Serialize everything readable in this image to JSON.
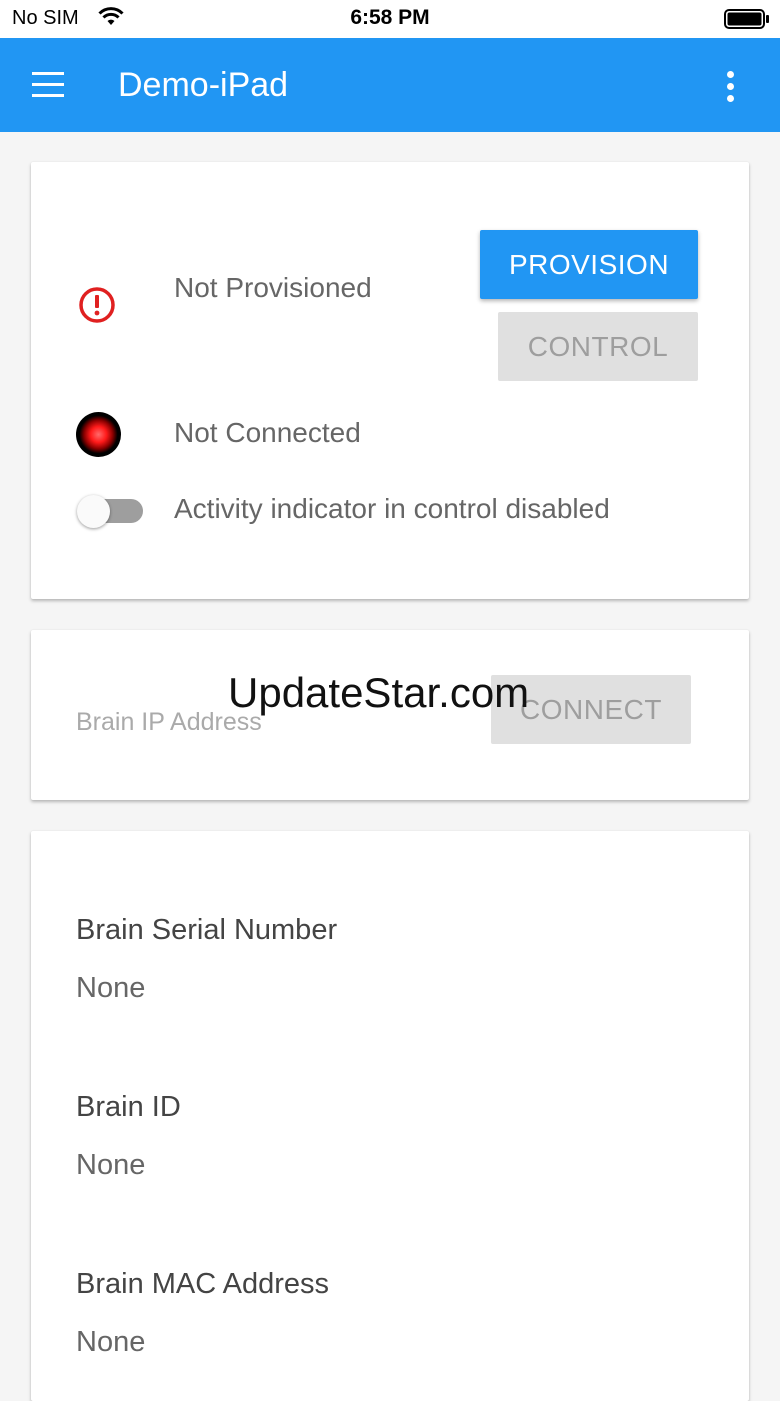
{
  "status_bar": {
    "carrier": "No SIM",
    "time": "6:58 PM"
  },
  "app_bar": {
    "title": "Demo-iPad",
    "color": "#2196f3"
  },
  "device_card": {
    "provision_status": "Not Provisioned",
    "provision_button": "PROVISION",
    "control_button": "CONTROL",
    "connection_status": "Not Connected",
    "activity_toggle_label": "Activity indicator in control disabled",
    "activity_toggle_on": false
  },
  "connect_card": {
    "ip_placeholder": "Brain IP Address",
    "ip_value": "",
    "connect_button": "CONNECT",
    "watermark": "UpdateStar.com"
  },
  "info_card": {
    "fields": [
      {
        "label": "Brain Serial Number",
        "value": "None"
      },
      {
        "label": "Brain ID",
        "value": "None"
      },
      {
        "label": "Brain MAC Address",
        "value": "None"
      }
    ]
  }
}
